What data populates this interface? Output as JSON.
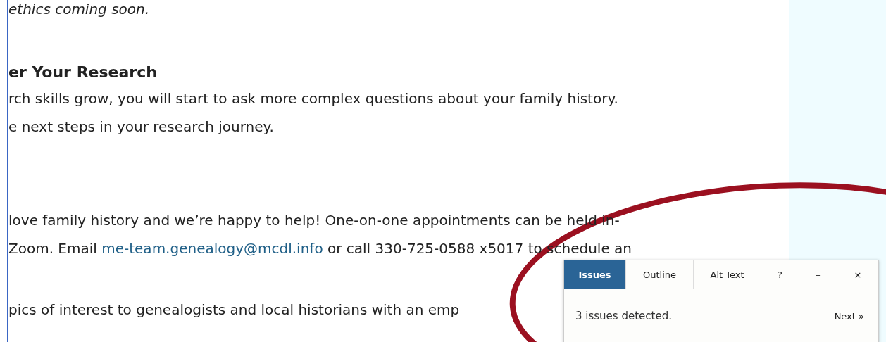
{
  "article": {
    "lines": [
      {
        "kind": "italic",
        "text": "ethics coming soon."
      },
      {
        "kind": "heading",
        "text": "er Your Research"
      },
      {
        "kind": "text",
        "text": "rch skills grow, you will start to ask more complex questions about your family history."
      },
      {
        "kind": "text",
        "text": "e next steps in your research journey."
      },
      {
        "kind": "text-gap",
        "text": " love family history and we’re happy to help! One-on-one appointments can be held in-"
      },
      {
        "kind": "link-line",
        "before": "Zoom. Email ",
        "link": "me-team.genealogy@mcdl.info",
        "after": " or call 330-725-0588 x5017 to schedule an"
      },
      {
        "kind": "text-gap-small",
        "text": "pics of interest to genealogists and local historians with an emp"
      }
    ]
  },
  "checker": {
    "tabs": [
      {
        "label": "Issues",
        "selected": true
      },
      {
        "label": "Outline",
        "selected": false
      },
      {
        "label": "Alt Text",
        "selected": false
      }
    ],
    "help": "?",
    "minimize": "–",
    "close": "×",
    "message": "3 issues detected.",
    "next": "Next »"
  }
}
